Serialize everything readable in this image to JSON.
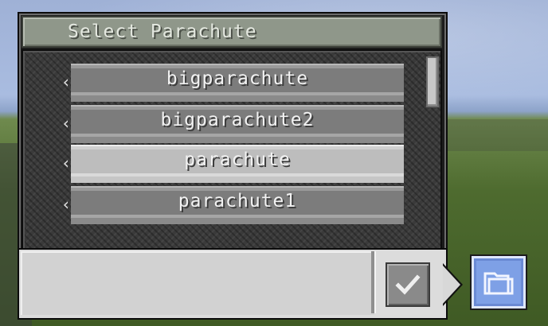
{
  "dialog": {
    "title": "Select Parachute"
  },
  "list": {
    "items": [
      {
        "label": "bigparachute",
        "selected": false
      },
      {
        "label": "bigparachute2",
        "selected": false
      },
      {
        "label": "parachute",
        "selected": true
      },
      {
        "label": "parachute1",
        "selected": false
      }
    ],
    "arrow_glyph": "‹"
  },
  "input": {
    "value": ""
  },
  "icons": {
    "confirm": "checkmark-icon",
    "folder": "folder-icon",
    "accent_folder": "#7ea0e6"
  }
}
